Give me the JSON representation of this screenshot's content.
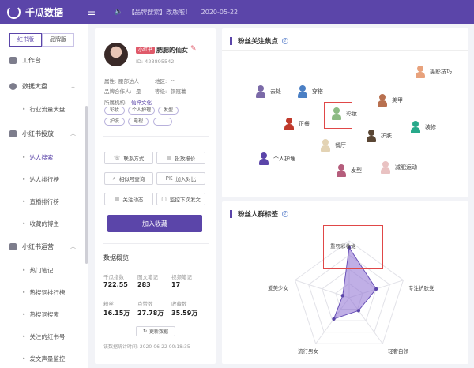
{
  "topbar": {
    "app_name": "千瓜数据",
    "notice_text": "【品牌搜索】改版啦！",
    "notice_date": "2020-05-22"
  },
  "sidebar": {
    "segments": [
      "红书版",
      "品牌版"
    ],
    "items": [
      {
        "label": "工作台"
      },
      {
        "label": "数据大盘"
      },
      {
        "label": "行业流量大盘"
      },
      {
        "label": "小红书投放"
      },
      {
        "label": "达人搜索"
      },
      {
        "label": "达人排行榜"
      },
      {
        "label": "直播排行榜"
      },
      {
        "label": "收藏的博主"
      },
      {
        "label": "小红书运营"
      },
      {
        "label": "热门笔记"
      },
      {
        "label": "热搜词排行榜"
      },
      {
        "label": "热搜词搜索"
      },
      {
        "label": "关注的红书号"
      },
      {
        "label": "发文声量监控"
      }
    ]
  },
  "profile": {
    "badge": "小红书",
    "name": "肥肥的仙女",
    "id": "ID: 423895542",
    "attr_label": "属性:",
    "attr_value": "腰部达人",
    "region_label": "地区:",
    "region_value": "--",
    "brand_label": "品牌合作人:",
    "brand_value": "是",
    "level_label": "等级:",
    "level_value": "铜冠薯",
    "agency_label": "所属机构:",
    "agency_value": "仙梓文化",
    "tags": [
      "彩妆",
      "个人护理",
      "发型",
      "护肤",
      "电视",
      "..."
    ],
    "actions": [
      "联系方式",
      "投放报价",
      "相似号查询",
      "加入对比",
      "关注动态",
      "监控下次发文"
    ],
    "action_icons": [
      "phone-icon",
      "doc-icon",
      "search-icon",
      "pk-icon",
      "chart-icon",
      "monitor-icon"
    ],
    "pk_glyph": "PK",
    "primary_button": "加入收藏",
    "overview_title": "数据概览",
    "stats": [
      {
        "label": "千瓜指数",
        "value": "722.55"
      },
      {
        "label": "图文笔记",
        "value": "283"
      },
      {
        "label": "视频笔记",
        "value": "17"
      },
      {
        "label": "粉丝",
        "value": "16.15万"
      },
      {
        "label": "点赞数",
        "value": "27.78万"
      },
      {
        "label": "收藏数",
        "value": "35.59万"
      }
    ],
    "refresh_label": "更新数据",
    "updated_at": "该数据统计时间: 2020-06-22 00:18:35"
  },
  "focus": {
    "title": "粉丝关注焦点",
    "help": "?",
    "items": [
      {
        "label": "摄影技巧",
        "color": "#e8a27c"
      },
      {
        "label": "去处",
        "color": "#7b6aa8"
      },
      {
        "label": "穿搭",
        "color": "#4a7fc4"
      },
      {
        "label": "美甲",
        "color": "#b8704f"
      },
      {
        "label": "彩妆",
        "color": "#8dbb84"
      },
      {
        "label": "正餐",
        "color": "#c0392b"
      },
      {
        "label": "装修",
        "color": "#27a98a"
      },
      {
        "label": "护肤",
        "color": "#5a4634"
      },
      {
        "label": "餐厅",
        "color": "#e3d3b4"
      },
      {
        "label": "个人护理",
        "color": "#5b45a9"
      },
      {
        "label": "发型",
        "color": "#b55d7c"
      },
      {
        "label": "减肥运动",
        "color": "#e9c2c2"
      }
    ]
  },
  "fan_tags": {
    "title": "粉丝人群标签",
    "help": "?",
    "chart_data": {
      "type": "radar",
      "categories": [
        "重罚彩妆党",
        "专注护肤党",
        "轻奢白领",
        "流行男女",
        "爱美少女"
      ],
      "values": [
        0.88,
        0.5,
        0.28,
        0.46,
        0.12
      ],
      "max": 1
    }
  }
}
